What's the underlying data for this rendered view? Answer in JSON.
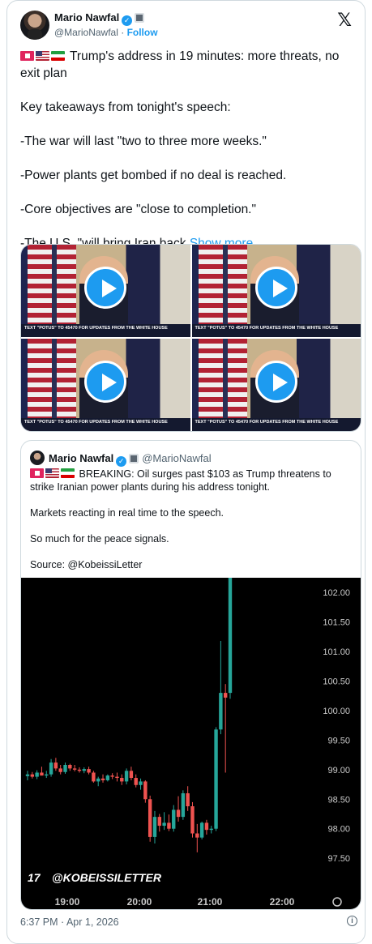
{
  "author": {
    "name": "Mario Nawfal",
    "handle": "@MarioNawfal",
    "separator": "·",
    "follow_label": "Follow"
  },
  "post": {
    "lines": [
      "Trump's address in 19 minutes: more threats, no exit plan",
      "Key takeaways from tonight's speech:",
      "-The war will last \"two to three more weeks.\"",
      "-Power plants get bombed if no deal is reached.",
      "-Core objectives are \"close to completion.\"",
      "-The U.S. \"will bring Iran back"
    ],
    "show_more": "Show more"
  },
  "media": {
    "videos": [
      {
        "caption": "TEXT \"POTUS\" TO 45470 FOR UPDATES FROM THE WHITE HOUSE"
      },
      {
        "caption": "TEXT \"POTUS\" TO 45470 FOR UPDATES FROM THE WHITE HOUSE"
      },
      {
        "caption": "TEXT \"POTUS\" TO 45470 FOR UPDATES FROM THE WHITE HOUSE"
      },
      {
        "caption": "TEXT \"POTUS\" TO 45470 FOR UPDATES FROM THE WHITE HOUSE"
      }
    ]
  },
  "quote": {
    "name": "Mario Nawfal",
    "handle": "@MarioNawfal",
    "text": "BREAKING: Oil surges past $103 as Trump threatens to strike Iranian power plants during his address tonight.",
    "line2": "Markets reacting in real time to the speech.",
    "line3": "So much for the peace signals.",
    "line4": "Source: @KobeissiLetter"
  },
  "chart_data": {
    "type": "candlestick",
    "watermark": "@KOBEISSILETTER",
    "x_ticks": [
      "19:00",
      "20:00",
      "21:00",
      "22:00"
    ],
    "y_ticks": [
      "102.00",
      "101.50",
      "101.00",
      "100.50",
      "100.00",
      "99.50",
      "99.00",
      "98.50",
      "98.00",
      "97.50"
    ],
    "ylim": [
      97.2,
      102.25
    ],
    "up_color": "#26a69a",
    "down_color": "#ef5350",
    "candles": [
      {
        "o": 98.89,
        "h": 98.98,
        "l": 98.82,
        "c": 98.92
      },
      {
        "o": 98.92,
        "h": 98.96,
        "l": 98.85,
        "c": 98.88
      },
      {
        "o": 98.88,
        "h": 98.99,
        "l": 98.84,
        "c": 98.95
      },
      {
        "o": 98.95,
        "h": 99.05,
        "l": 98.9,
        "c": 98.9
      },
      {
        "o": 98.9,
        "h": 98.98,
        "l": 98.86,
        "c": 98.92
      },
      {
        "o": 98.92,
        "h": 99.18,
        "l": 98.88,
        "c": 99.12
      },
      {
        "o": 99.12,
        "h": 99.2,
        "l": 98.98,
        "c": 99.02
      },
      {
        "o": 99.02,
        "h": 99.08,
        "l": 98.92,
        "c": 98.96
      },
      {
        "o": 98.96,
        "h": 99.12,
        "l": 98.93,
        "c": 99.08
      },
      {
        "o": 99.08,
        "h": 99.1,
        "l": 98.98,
        "c": 99.02
      },
      {
        "o": 99.02,
        "h": 99.08,
        "l": 98.97,
        "c": 99.0
      },
      {
        "o": 99.0,
        "h": 99.04,
        "l": 98.95,
        "c": 98.98
      },
      {
        "o": 98.98,
        "h": 99.04,
        "l": 98.94,
        "c": 99.01
      },
      {
        "o": 99.01,
        "h": 99.05,
        "l": 98.92,
        "c": 98.95
      },
      {
        "o": 98.95,
        "h": 98.98,
        "l": 98.78,
        "c": 98.8
      },
      {
        "o": 98.8,
        "h": 98.88,
        "l": 98.72,
        "c": 98.85
      },
      {
        "o": 98.85,
        "h": 98.92,
        "l": 98.78,
        "c": 98.82
      },
      {
        "o": 98.82,
        "h": 98.92,
        "l": 98.8,
        "c": 98.9
      },
      {
        "o": 98.9,
        "h": 98.94,
        "l": 98.84,
        "c": 98.88
      },
      {
        "o": 98.88,
        "h": 98.95,
        "l": 98.8,
        "c": 98.86
      },
      {
        "o": 98.86,
        "h": 98.92,
        "l": 98.74,
        "c": 98.8
      },
      {
        "o": 98.8,
        "h": 99.02,
        "l": 98.75,
        "c": 98.98
      },
      {
        "o": 98.98,
        "h": 99.05,
        "l": 98.82,
        "c": 98.86
      },
      {
        "o": 98.86,
        "h": 98.92,
        "l": 98.7,
        "c": 98.74
      },
      {
        "o": 98.74,
        "h": 98.85,
        "l": 98.66,
        "c": 98.8
      },
      {
        "o": 98.8,
        "h": 98.82,
        "l": 98.44,
        "c": 98.5
      },
      {
        "o": 98.5,
        "h": 98.56,
        "l": 97.78,
        "c": 97.86
      },
      {
        "o": 97.86,
        "h": 98.3,
        "l": 97.75,
        "c": 98.2
      },
      {
        "o": 98.2,
        "h": 98.25,
        "l": 97.95,
        "c": 98.05
      },
      {
        "o": 98.05,
        "h": 98.28,
        "l": 97.98,
        "c": 98.1
      },
      {
        "o": 98.1,
        "h": 98.24,
        "l": 97.96,
        "c": 98.0
      },
      {
        "o": 98.0,
        "h": 98.4,
        "l": 97.95,
        "c": 98.32
      },
      {
        "o": 98.32,
        "h": 98.55,
        "l": 98.12,
        "c": 98.2
      },
      {
        "o": 98.2,
        "h": 98.65,
        "l": 98.15,
        "c": 98.6
      },
      {
        "o": 98.6,
        "h": 98.72,
        "l": 98.3,
        "c": 98.38
      },
      {
        "o": 98.38,
        "h": 98.45,
        "l": 97.85,
        "c": 97.92
      },
      {
        "o": 97.92,
        "h": 98.08,
        "l": 97.6,
        "c": 97.85
      },
      {
        "o": 97.85,
        "h": 98.12,
        "l": 97.82,
        "c": 98.1
      },
      {
        "o": 98.1,
        "h": 98.15,
        "l": 97.9,
        "c": 97.98
      },
      {
        "o": 97.98,
        "h": 98.05,
        "l": 97.92,
        "c": 98.0
      },
      {
        "o": 98.0,
        "h": 99.72,
        "l": 97.96,
        "c": 99.68
      },
      {
        "o": 99.68,
        "h": 101.18,
        "l": 99.6,
        "c": 100.3
      },
      {
        "o": 100.3,
        "h": 100.45,
        "l": 98.95,
        "c": 100.22
      },
      {
        "o": 100.3,
        "h": 102.6,
        "l": 100.2,
        "c": 102.6
      }
    ]
  }
}
